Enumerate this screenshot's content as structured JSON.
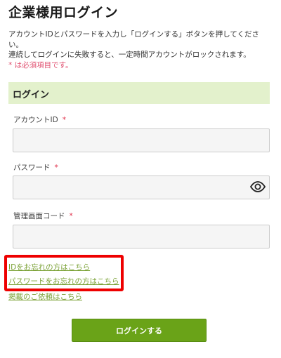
{
  "page": {
    "title": "企業様用ログイン",
    "intro_line1": "アカウントIDとパスワードを入力し「ログインする」ボタンを押してください。",
    "intro_line2": "連続してログインに失敗すると、一定時間アカウントがロックされます。",
    "required_note": "* は必須項目です。"
  },
  "login_section": {
    "heading": "ログイン",
    "account_id": {
      "label": "アカウントID",
      "required_mark": "*",
      "value": ""
    },
    "password": {
      "label": "パスワード",
      "required_mark": "*",
      "value": "",
      "toggle_icon": "eye-icon"
    },
    "admin_code": {
      "label": "管理画面コード",
      "required_mark": "*",
      "value": ""
    }
  },
  "links": {
    "forgot_id": "IDをお忘れの方はこちら",
    "forgot_password": "パスワードをお忘れの方はこちら",
    "listing_inquiry": "掲載のご依頼はこちら"
  },
  "submit_label": "ログインする",
  "colors": {
    "accent_green": "#6aa318",
    "section_bg": "#e3f1cc",
    "link_green": "#7aa135",
    "required_red": "#e0304a",
    "highlight_red": "#ee0000"
  }
}
